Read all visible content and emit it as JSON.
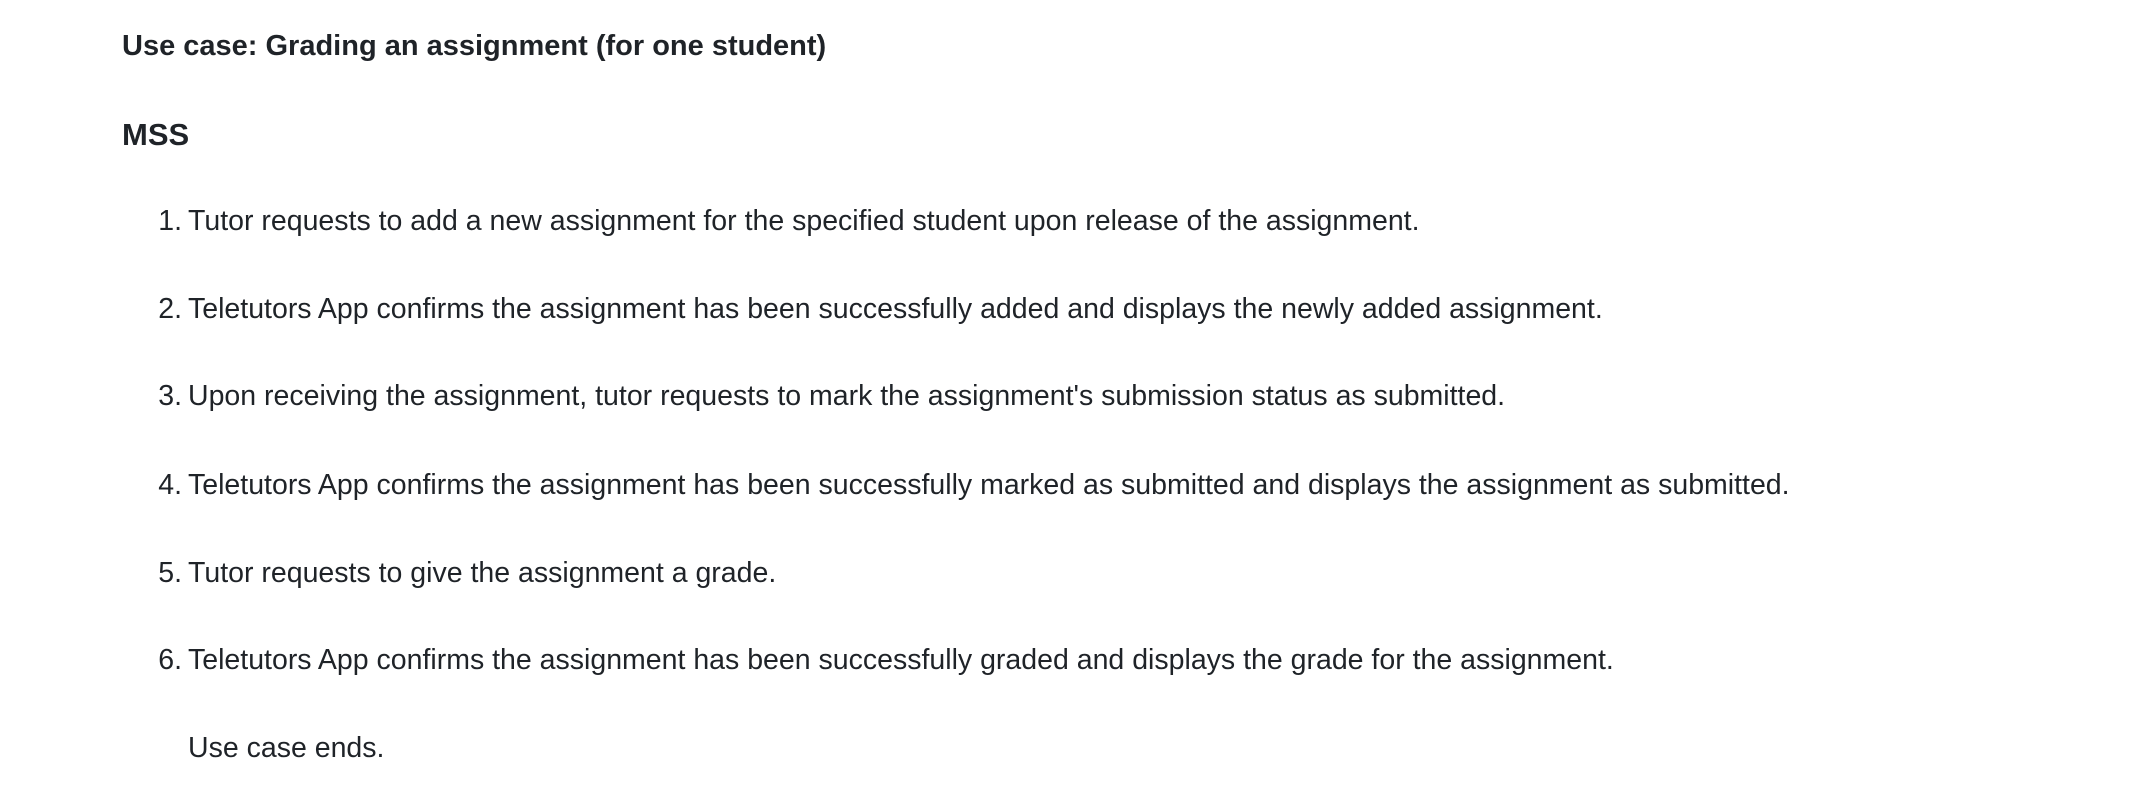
{
  "document": {
    "title": "Use case: Grading an assignment (for one student)",
    "section_heading": "MSS",
    "steps": [
      {
        "number": "1.",
        "text": "Tutor requests to add a new assignment for the specified student upon release of the assignment."
      },
      {
        "number": "2.",
        "text": "Teletutors App confirms the assignment has been successfully added and displays the newly added assignment."
      },
      {
        "number": "3.",
        "text": "Upon receiving the assignment, tutor requests to mark the assignment's submission status as submitted."
      },
      {
        "number": "4.",
        "text": "Teletutors App confirms the assignment has been successfully marked as submitted and displays the assignment as submitted."
      },
      {
        "number": "5.",
        "text": "Tutor requests to give the assignment a grade."
      },
      {
        "number": "6.",
        "text": "Teletutors App confirms the assignment has been successfully graded and displays the grade for the assignment."
      }
    ],
    "ending": "Use case ends."
  }
}
